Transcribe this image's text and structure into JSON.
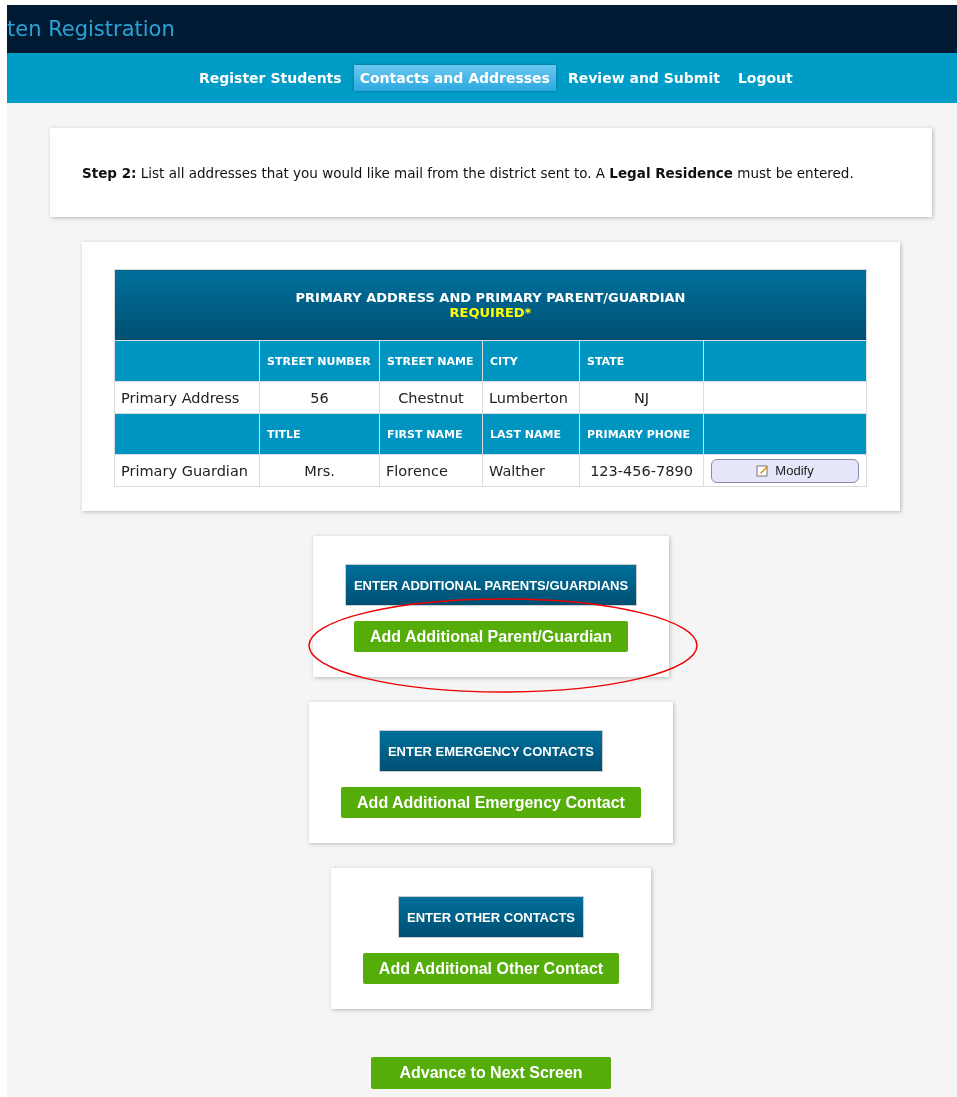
{
  "app_title": "ten Registration",
  "nav": [
    {
      "label": "Register Students",
      "selected": false
    },
    {
      "label": "Contacts and Addresses",
      "selected": true
    },
    {
      "label": "Review and Submit",
      "selected": false
    },
    {
      "label": "Logout",
      "selected": false
    }
  ],
  "instructions": "**Step 2:**  List all addresses that you would like mail from the district sent to. A **Legal Residence** must be entered.",
  "primary_table": {
    "title": "PRIMARY ADDRESS AND PRIMARY PARENT/GUARDIAN",
    "required": "REQUIRED*",
    "groups": [
      {
        "columns": [
          "STREET NUMBER",
          "STREET NAME",
          "CITY",
          "STATE"
        ],
        "row": {
          "label": "Primary Address",
          "cells": [
            "56",
            "Chestnut",
            "Lumberton",
            "NJ"
          ]
        }
      },
      {
        "columns": [
          "TITLE",
          "FIRST NAME",
          "LAST NAME",
          "PRIMARY PHONE"
        ],
        "row": {
          "label": "Primary Guardian",
          "cells": [
            "Mrs.",
            "Florence",
            "Walther",
            "123-456-7890"
          ],
          "action": "Modify"
        }
      }
    ]
  },
  "sections": [
    {
      "heading": "ENTER ADDITIONAL PARENTS/GUARDIANS",
      "button": "Add Additional Parent/Guardian",
      "circled": true
    },
    {
      "heading": "ENTER EMERGENCY CONTACTS",
      "button": "Add Additional Emergency Contact",
      "circled": false
    },
    {
      "heading": "ENTER OTHER CONTACTS",
      "button": "Add Additional Other Contact",
      "circled": false
    }
  ],
  "advance_button": "Advance to Next Screen"
}
